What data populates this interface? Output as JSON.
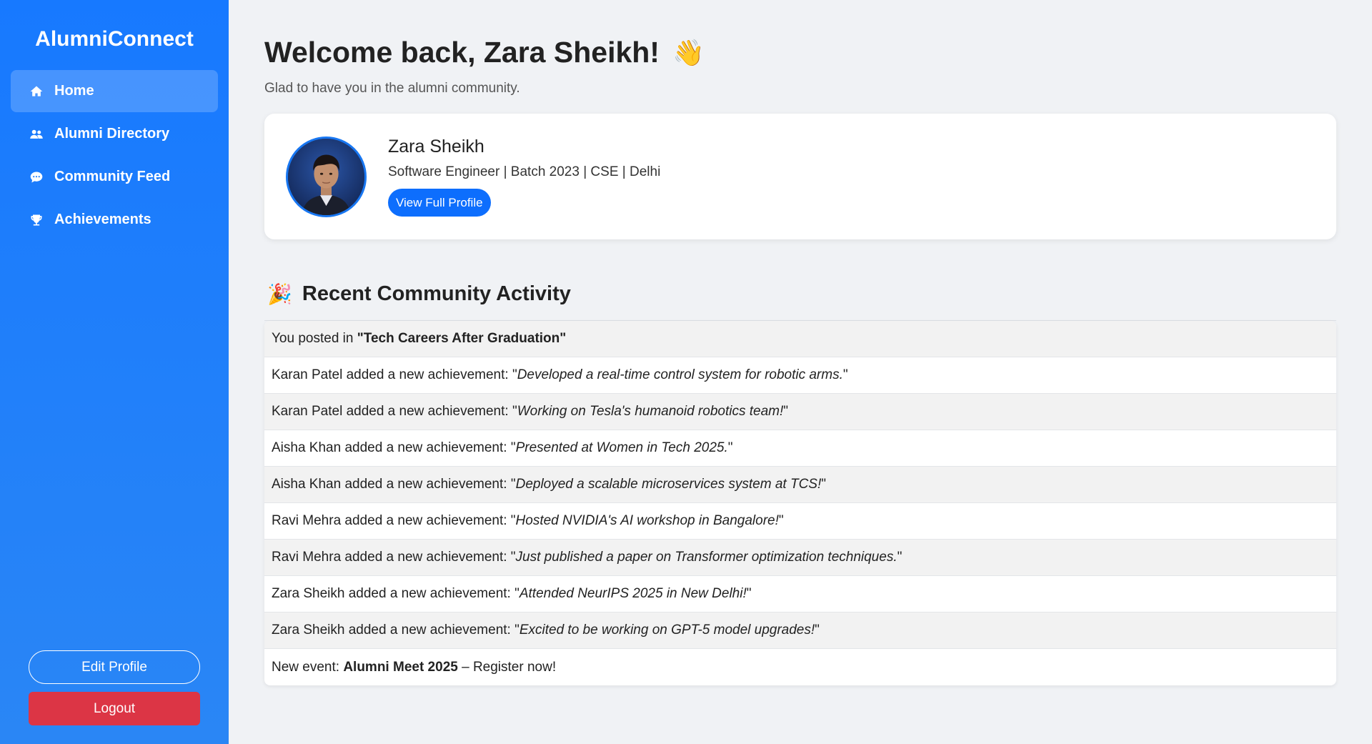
{
  "sidebar": {
    "brand": "AlumniConnect",
    "nav": [
      {
        "label": "Home",
        "icon": "home-icon"
      },
      {
        "label": "Alumni Directory",
        "icon": "users-icon"
      },
      {
        "label": "Community Feed",
        "icon": "chat-icon"
      },
      {
        "label": "Achievements",
        "icon": "trophy-icon"
      }
    ],
    "edit_profile": "Edit Profile",
    "logout": "Logout"
  },
  "main": {
    "welcome": "Welcome back, Zara Sheikh!",
    "wave": "👋",
    "subtitle": "Glad to have you in the alumni community."
  },
  "profile": {
    "name": "Zara Sheikh",
    "meta": "Software Engineer | Batch 2023 | CSE | Delhi",
    "view_button": "View Full Profile"
  },
  "activity": {
    "icon": "🎉",
    "heading": "Recent Community Activity",
    "items": [
      {
        "prefix": "You posted in ",
        "bold": "\"Tech Careers After Graduation\"",
        "italic": "",
        "suffix": ""
      },
      {
        "prefix": "Karan Patel added a new achievement: \"",
        "bold": "",
        "italic": "Developed a real-time control system for robotic arms.",
        "suffix": "\""
      },
      {
        "prefix": "Karan Patel added a new achievement: \"",
        "bold": "",
        "italic": "Working on Tesla's humanoid robotics team!",
        "suffix": "\""
      },
      {
        "prefix": "Aisha Khan added a new achievement: \"",
        "bold": "",
        "italic": "Presented at Women in Tech 2025.",
        "suffix": "\""
      },
      {
        "prefix": "Aisha Khan added a new achievement: \"",
        "bold": "",
        "italic": "Deployed a scalable microservices system at TCS!",
        "suffix": "\""
      },
      {
        "prefix": "Ravi Mehra added a new achievement: \"",
        "bold": "",
        "italic": "Hosted NVIDIA's AI workshop in Bangalore!",
        "suffix": "\""
      },
      {
        "prefix": "Ravi Mehra added a new achievement: \"",
        "bold": "",
        "italic": "Just published a paper on Transformer optimization techniques.",
        "suffix": "\""
      },
      {
        "prefix": "Zara Sheikh added a new achievement: \"",
        "bold": "",
        "italic": "Attended NeurIPS 2025 in New Delhi!",
        "suffix": "\""
      },
      {
        "prefix": "Zara Sheikh added a new achievement: \"",
        "bold": "",
        "italic": "Excited to be working on GPT-5 model upgrades!",
        "suffix": "\""
      },
      {
        "prefix": "New event: ",
        "bold": "Alumni Meet 2025",
        "italic": "",
        "suffix": " – Register now!"
      }
    ]
  },
  "colors": {
    "sidebar": "#1779ff",
    "primary_button": "#0d6efd",
    "logout": "#dc3545",
    "background": "#f0f2f5"
  }
}
